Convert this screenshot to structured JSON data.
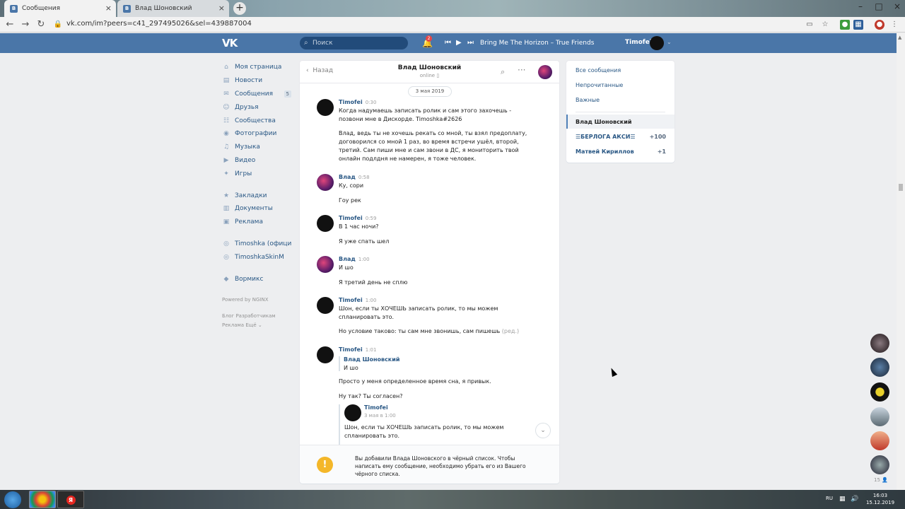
{
  "browser": {
    "tabs": [
      {
        "title": "Сообщения",
        "active": true
      },
      {
        "title": "Влад Шоновский",
        "active": false
      }
    ],
    "url": "vk.com/im?peers=c41_297495026&sel=439887004"
  },
  "header": {
    "logo": "VK",
    "search_placeholder": "Поиск",
    "notifications_count": "2",
    "track": "Bring Me The Horizon – True Friends",
    "user_name": "Timofei"
  },
  "left_menu": {
    "items": [
      {
        "label": "Моя страница",
        "icon": "home-icon"
      },
      {
        "label": "Новости",
        "icon": "news-icon"
      },
      {
        "label": "Сообщения",
        "icon": "messages-icon",
        "count": "5"
      },
      {
        "label": "Друзья",
        "icon": "friends-icon"
      },
      {
        "label": "Сообщества",
        "icon": "communities-icon"
      },
      {
        "label": "Фотографии",
        "icon": "camera-icon"
      },
      {
        "label": "Музыка",
        "icon": "music-icon"
      },
      {
        "label": "Видео",
        "icon": "video-icon"
      },
      {
        "label": "Игры",
        "icon": "games-icon"
      }
    ],
    "items2": [
      {
        "label": "Закладки",
        "icon": "star-icon"
      },
      {
        "label": "Документы",
        "icon": "document-icon"
      },
      {
        "label": "Реклама",
        "icon": "ads-icon"
      }
    ],
    "items3": [
      {
        "label": "Timoshka (офици",
        "icon": "group-icon"
      },
      {
        "label": "TimoshkaSkinM",
        "icon": "group-icon"
      }
    ],
    "items4": [
      {
        "label": "Вормикс",
        "icon": "game-app-icon"
      }
    ],
    "powered": "Powered by NGINX",
    "footer_line1": "Блог   Разработчикам",
    "footer_line2": "Реклама   Ещё ⌄"
  },
  "chat": {
    "back_label": "Назад",
    "peer_name": "Влад Шоновский",
    "peer_status": "online",
    "date_pill": "3 мая 2019",
    "messages": [
      {
        "author": "Timofei",
        "time": "0:30",
        "lines": [
          "Когда надумаешь записать ролик и сам этого захочешь -\nпозвони мне в Дискорде. Timoshka#2626",
          "Влад, ведь ты не хочешь рекать со мной, ты взял предоплату,\nдоговорился со мной 1 раз, во время встречи ушёл, второй,\nтретий. Сам пиши мне и сам звони в ДС, я мониторить твой\nонлайн подлдня не намерен, я тоже человек."
        ]
      },
      {
        "author": "Влад",
        "time": "0:58",
        "lines": [
          "Ку, сори",
          "Гоу рек"
        ]
      },
      {
        "author": "Timofei",
        "time": "0:59",
        "lines": [
          "В 1 час ночи?",
          "Я уже спать шел"
        ]
      },
      {
        "author": "Влад",
        "time": "1:00",
        "lines": [
          "И шо",
          "Я третий день не сплю"
        ]
      },
      {
        "author": "Timofei",
        "time": "1:00",
        "lines": [
          "Шон, если ты ХОЧЕШЬ записать ролик, то мы можем\nспланировать это.",
          "Но условие таково: ты сам мне звонишь, сам пишешь"
        ],
        "edited": "(ред.)"
      },
      {
        "author": "Timofei",
        "time": "1:01",
        "reply_author": "Влад Шоновский",
        "reply_text": "И шо",
        "lines": [
          "Просто у меня определенное время сна, я привык.",
          "Ну так? Ты согласен?"
        ],
        "forwarded": {
          "author": "Timofei",
          "date": "3 мая в 1:00",
          "text": "Шон, если ты ХОЧЕШЬ записать ролик, то мы можем\nспланировать это."
        }
      }
    ],
    "blocked_notice": "Вы добавили Влада Шоновского в чёрный список. Чтобы\nнаписать ему сообщение, необходимо убрать его из Вашего\nчёрного списка."
  },
  "folders": {
    "items": [
      "Все сообщения",
      "Непрочитанные",
      "Важные"
    ],
    "selected": "Влад Шоновский",
    "chats": [
      {
        "name": "☰БЕРЛОГА АКСИ☰",
        "count": "+100"
      },
      {
        "name": "Матвей Кириллов",
        "count": "+1"
      }
    ]
  },
  "right_sidebar": {
    "count": "15"
  },
  "taskbar": {
    "lang": "RU",
    "time": "16:03",
    "date": "15.12.2019"
  },
  "colors": {
    "vk_blue": "#4a76a8",
    "link": "#2a5885",
    "warning": "#f4b729"
  }
}
